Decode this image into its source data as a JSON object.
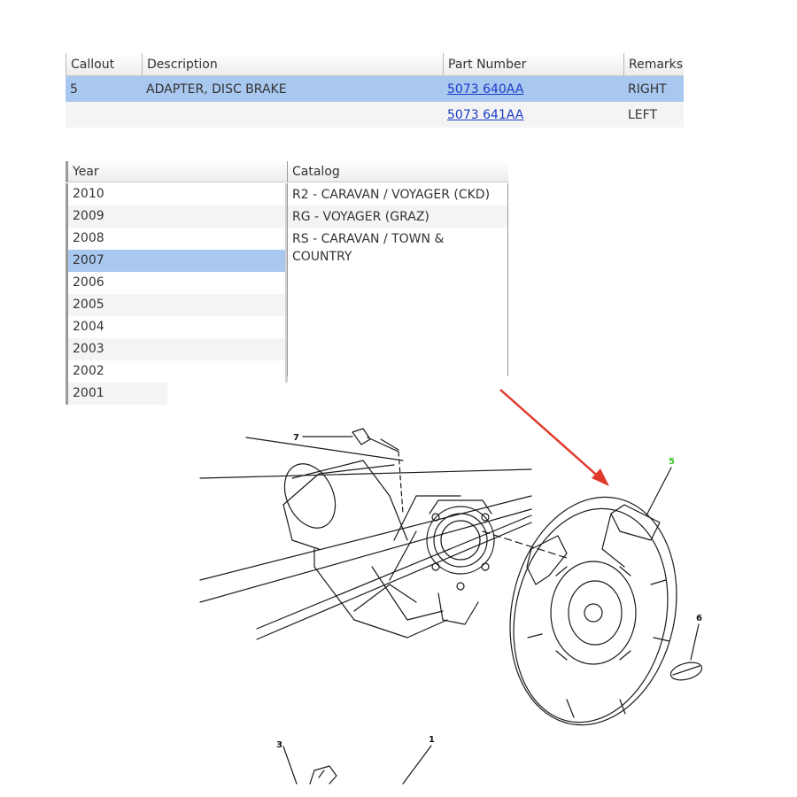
{
  "parts_table": {
    "headers": {
      "callout": "Callout",
      "description": "Description",
      "part_number": "Part Number",
      "remarks": "Remarks"
    },
    "rows": [
      {
        "callout": "5",
        "description": "ADAPTER, DISC BRAKE",
        "part_number": "5073 640AA",
        "remarks": "RIGHT"
      },
      {
        "callout": "",
        "description": "",
        "part_number": "5073 641AA",
        "remarks": "LEFT"
      }
    ]
  },
  "year_list": {
    "header": "Year",
    "selected": "2007",
    "items": [
      "2010",
      "2009",
      "2008",
      "2007",
      "2006",
      "2005",
      "2004",
      "2003",
      "2002",
      "2001"
    ]
  },
  "catalog_list": {
    "header": "Catalog",
    "items": [
      "R2 - CARAVAN / VOYAGER (CKD)",
      "RG - VOYAGER (GRAZ)",
      "RS - CARAVAN / TOWN & COUNTRY"
    ]
  },
  "diagram": {
    "callouts": [
      "7",
      "5",
      "6",
      "3",
      "1"
    ],
    "highlight_color": "#3fbf2a",
    "arrow_color": "#e03a2c"
  },
  "colors": {
    "selection": "#a9c8ef",
    "link": "#1a3cc8"
  }
}
